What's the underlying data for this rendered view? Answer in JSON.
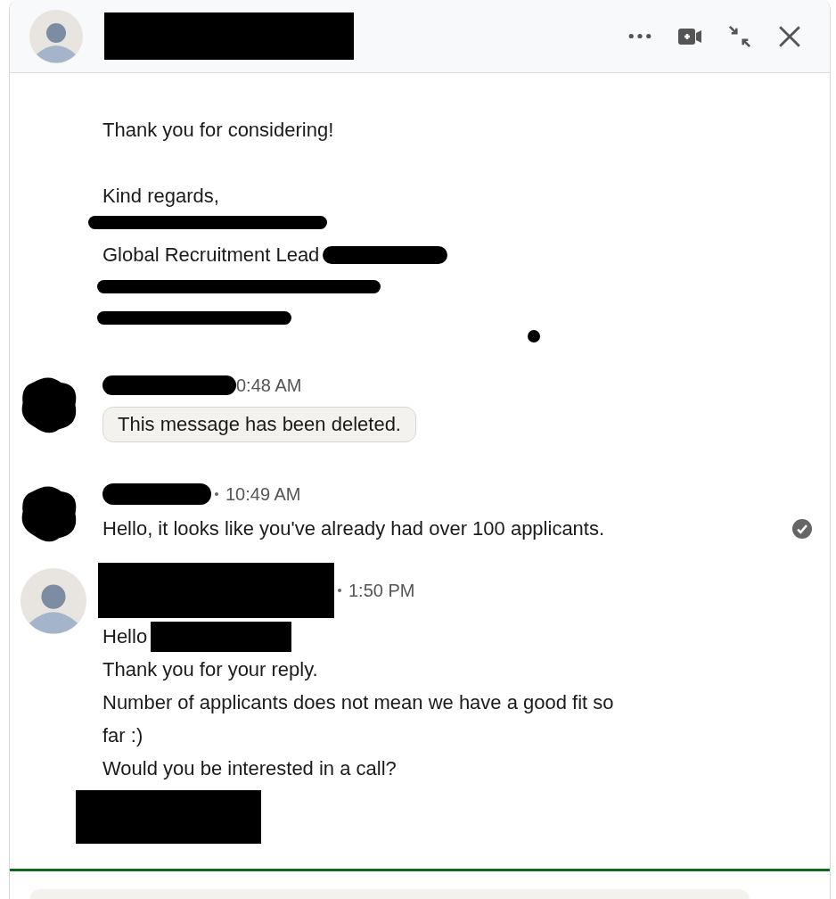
{
  "signature": {
    "closing": "Thank you for considering!",
    "sign_off": "Kind regards,",
    "title": "Global Recruitment Lead"
  },
  "messages": [
    {
      "kind": "deleted",
      "avatar": {
        "kind": "redacted"
      },
      "separator": false,
      "time": "0:48 AM",
      "text": "This message has been deleted.",
      "read": false
    },
    {
      "kind": "text",
      "avatar": {
        "kind": "redacted"
      },
      "separator": true,
      "time": "10:49 AM",
      "lines": [
        "Hello, it looks like you've already had over 100 applicants."
      ],
      "read": true
    },
    {
      "kind": "text",
      "avatar": {
        "kind": "silhouette"
      },
      "separator": true,
      "time": "1:50 PM",
      "greeting": "Hello",
      "lines": [
        "Thank you for your reply.",
        "Number of applicants does not mean we have a good fit so far :)",
        "Would you be interested in a call?"
      ],
      "read": false
    }
  ]
}
